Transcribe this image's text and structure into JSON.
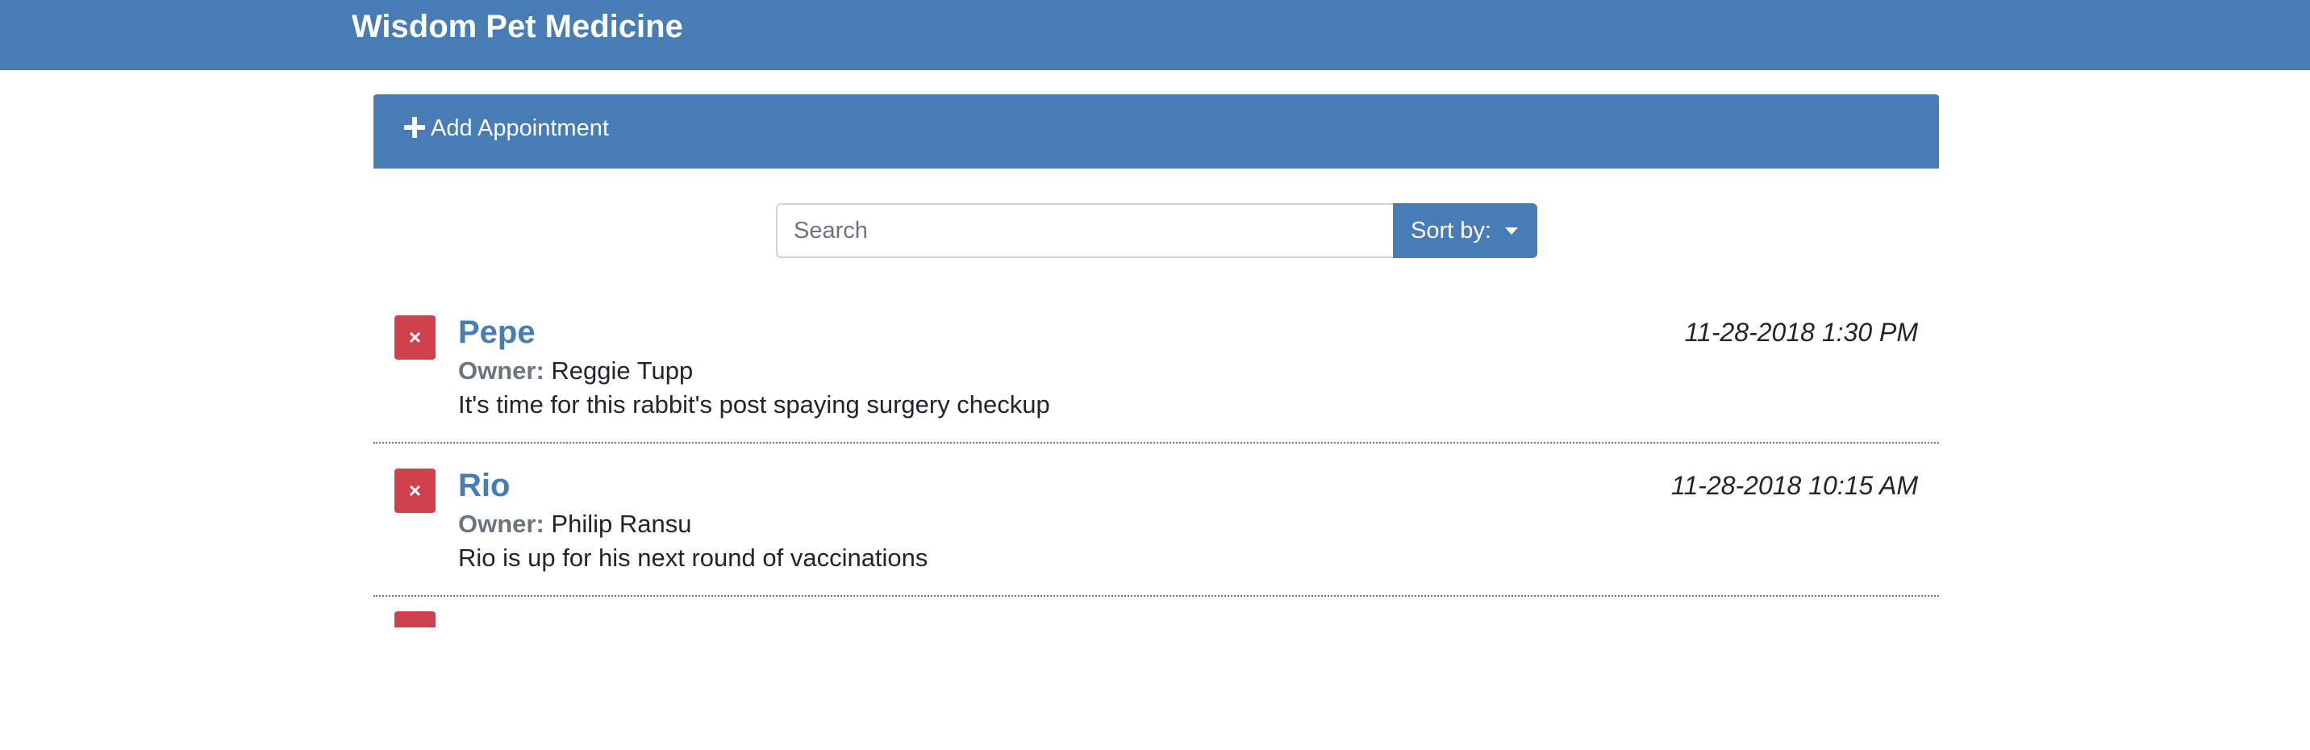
{
  "header": {
    "brand": "Wisdom Pet Medicine"
  },
  "add_appointment": {
    "label": "Add Appointment"
  },
  "search": {
    "placeholder": "Search",
    "value": "",
    "sort_label": "Sort by:"
  },
  "appointments": [
    {
      "pet_name": "Pepe",
      "owner_label": "Owner:",
      "owner_name": "Reggie Tupp",
      "notes": "It's time for this rabbit's post spaying surgery checkup",
      "date": "11-28-2018 1:30 PM",
      "delete_glyph": "×"
    },
    {
      "pet_name": "Rio",
      "owner_label": "Owner:",
      "owner_name": "Philip Ransu",
      "notes": "Rio is up for his next round of vaccinations",
      "date": "11-28-2018 10:15 AM",
      "delete_glyph": "×"
    }
  ],
  "colors": {
    "primary": "#477cb5",
    "danger": "#d1414d",
    "muted": "#6c757d"
  },
  "icons": {
    "add": "plus-icon",
    "delete": "close-icon",
    "sort": "caret-down-icon"
  }
}
